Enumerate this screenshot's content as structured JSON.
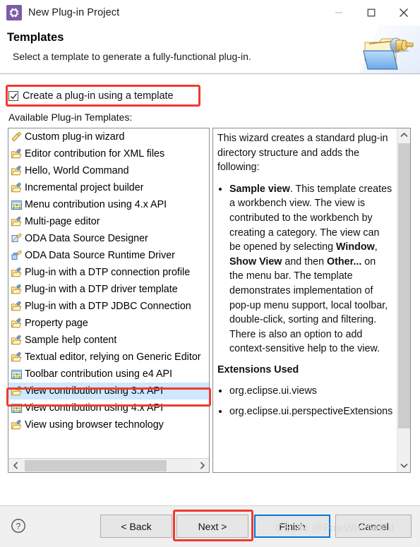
{
  "window": {
    "title": "New Plug-in Project",
    "icon": "plugin-gear-icon",
    "minimize_label": "Minimize",
    "maximize_label": "Maximize",
    "close_label": "Close"
  },
  "header": {
    "title": "Templates",
    "subtitle": "Select a template to generate a fully-functional plug-in.",
    "banner_icon": "folder-plug-banner-icon"
  },
  "options": {
    "create_from_template_label": "Create a plug-in using a template",
    "create_from_template_checked": true,
    "list_caption": "Available Plug-in Templates:"
  },
  "templates": [
    {
      "label": "Custom plug-in wizard",
      "icon": "custom-wizard-icon",
      "selected": false
    },
    {
      "label": "Editor contribution for XML files",
      "icon": "plugin-folder-icon",
      "selected": false
    },
    {
      "label": "Hello, World Command",
      "icon": "plugin-folder-icon",
      "selected": false
    },
    {
      "label": "Incremental project builder",
      "icon": "plugin-folder-icon",
      "selected": false
    },
    {
      "label": "Menu contribution using 4.x API",
      "icon": "grid-toolbar-icon",
      "selected": false
    },
    {
      "label": "Multi-page editor",
      "icon": "plugin-folder-icon",
      "selected": false
    },
    {
      "label": "ODA Data Source Designer",
      "icon": "oda-designer-icon",
      "selected": false
    },
    {
      "label": "ODA Data Source Runtime Driver",
      "icon": "oda-runtime-icon",
      "selected": false
    },
    {
      "label": "Plug-in with a DTP connection profile",
      "icon": "plugin-folder-icon",
      "selected": false
    },
    {
      "label": "Plug-in with a DTP driver template",
      "icon": "plugin-folder-icon",
      "selected": false
    },
    {
      "label": "Plug-in with a DTP JDBC Connection",
      "icon": "plugin-folder-icon",
      "selected": false
    },
    {
      "label": "Property page",
      "icon": "plugin-folder-icon",
      "selected": false
    },
    {
      "label": "Sample help content",
      "icon": "plugin-folder-icon",
      "selected": false
    },
    {
      "label": "Textual editor, relying on Generic Editor",
      "icon": "plugin-folder-icon",
      "selected": false
    },
    {
      "label": "Toolbar contribution using e4 API",
      "icon": "grid-toolbar-icon",
      "selected": false
    },
    {
      "label": "View contribution using 3.x API",
      "icon": "plugin-folder-icon",
      "selected": true
    },
    {
      "label": "View contribution using 4.x API",
      "icon": "grid-toolbar-icon",
      "selected": false
    },
    {
      "label": "View using browser technology",
      "icon": "plugin-folder-icon",
      "selected": false
    }
  ],
  "description": {
    "intro": "This wizard creates a standard plug-in directory structure and adds the following:",
    "bullets": [
      {
        "lead": "Sample view",
        "text": ". This template creates a workbench view. The view is contributed to the workbench by creating a category. The view can be opened by selecting ",
        "emph1": "Window",
        "text2": ", ",
        "emph2": "Show View",
        "text3": " and then ",
        "emph3": "Other...",
        "text4": " on the menu bar. The template demonstrates implementation of pop-up menu support, local toolbar, double-click, sorting and filtering. There is also an option to add context-sensitive help to the view."
      }
    ],
    "extensions_heading": "Extensions Used",
    "extensions": [
      "org.eclipse.ui.views",
      "org.eclipse.ui.perspectiveExtensions"
    ]
  },
  "scrollbars": {
    "list_left_arrow": "chevron-left-icon",
    "list_right_arrow": "chevron-right-icon",
    "desc_up_arrow": "chevron-up-icon",
    "desc_down_arrow": "chevron-down-icon"
  },
  "footer": {
    "help_label": "?",
    "back_label": "< Back",
    "next_label": "Next >",
    "finish_label": "Finish",
    "cancel_label": "Cancel",
    "default_button": "Finish"
  },
  "watermark": "CSDN @FireWhirlwind",
  "annotations": {
    "accent_color": "#f03a30",
    "selection_color": "#cde8ff",
    "default_button_border": "#0078d7"
  }
}
